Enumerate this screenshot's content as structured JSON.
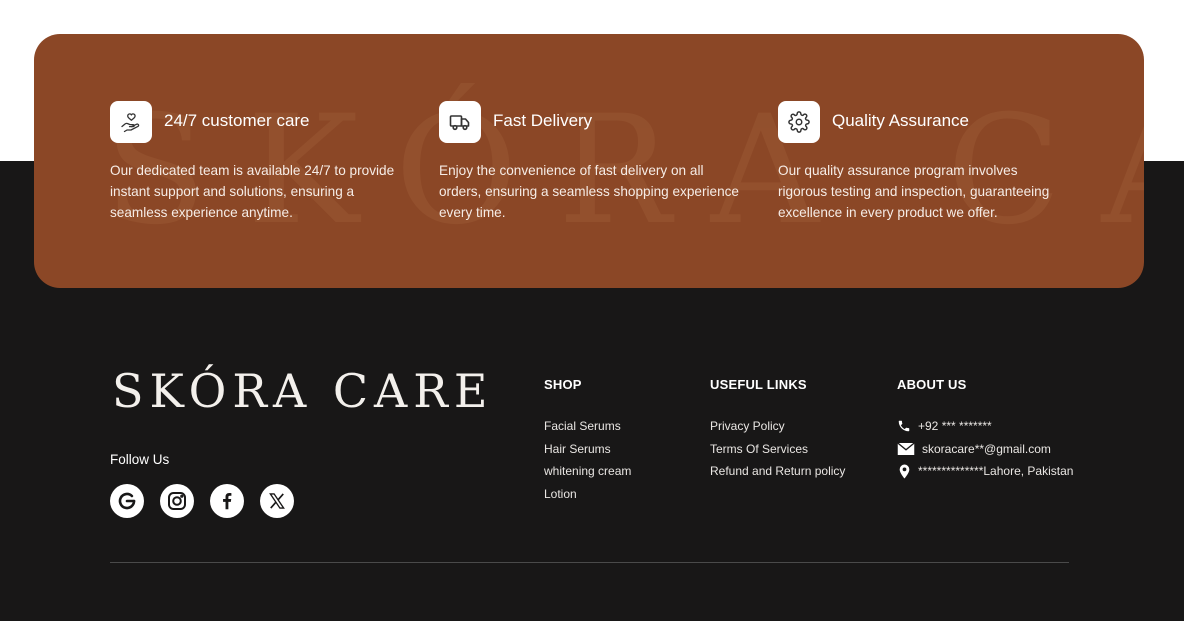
{
  "brand": {
    "logo_text": "SKÓRA CARE",
    "watermark_text": "SKÓRA CARE"
  },
  "features": [
    {
      "icon": "hand-heart-icon",
      "title": "24/7 customer care",
      "description": "Our dedicated team is available 24/7 to provide instant support and solutions, ensuring a seamless experience anytime."
    },
    {
      "icon": "truck-icon",
      "title": "Fast Delivery",
      "description": "Enjoy the convenience of fast delivery on all orders, ensuring a seamless shopping experience every time."
    },
    {
      "icon": "gear-icon",
      "title": "Quality Assurance",
      "description": "Our quality assurance program involves rigorous testing and inspection, guaranteeing excellence in every product we offer."
    }
  ],
  "follow": {
    "title": "Follow Us",
    "socials": [
      "google-icon",
      "instagram-icon",
      "facebook-icon",
      "x-icon"
    ]
  },
  "shop": {
    "title": "SHOP",
    "links": [
      "Facial Serums",
      "Hair Serums",
      "whitening cream",
      "Lotion"
    ]
  },
  "useful_links": {
    "title": "USEFUL LINKS",
    "links": [
      "Privacy Policy",
      "Terms Of Services",
      "Refund and Return policy"
    ]
  },
  "about": {
    "title": "ABOUT US",
    "phone": "+92 *** *******",
    "email": "skoracare**@gmail.com",
    "address": "**************Lahore, Pakistan"
  },
  "colors": {
    "banner": "#8b4726",
    "footer_bg": "#181717",
    "text_light": "#ffffff"
  }
}
